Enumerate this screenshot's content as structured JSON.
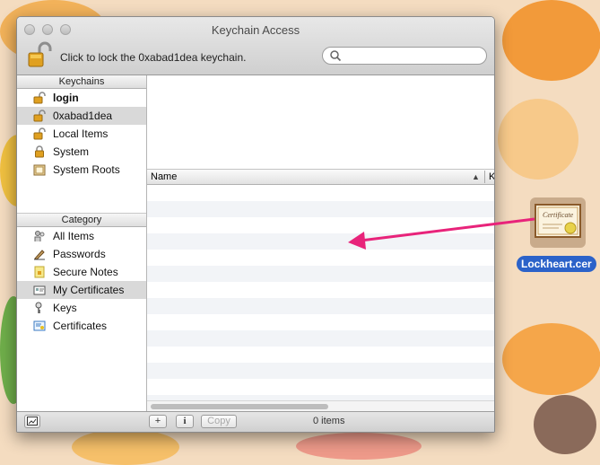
{
  "window": {
    "title": "Keychain Access"
  },
  "toolbar": {
    "lock_text": "Click to lock the 0xabad1dea keychain.",
    "search_placeholder": ""
  },
  "sidebar": {
    "keychains_header": "Keychains",
    "keychains": [
      {
        "label": "login",
        "icon": "lock-open-icon",
        "bold": true,
        "selected": false
      },
      {
        "label": "0xabad1dea",
        "icon": "lock-open-icon",
        "bold": false,
        "selected": true
      },
      {
        "label": "Local Items",
        "icon": "lock-open-icon",
        "bold": false,
        "selected": false
      },
      {
        "label": "System",
        "icon": "lock-closed-icon",
        "bold": false,
        "selected": false
      },
      {
        "label": "System Roots",
        "icon": "cabinet-icon",
        "bold": false,
        "selected": false
      }
    ],
    "category_header": "Category",
    "categories": [
      {
        "label": "All Items",
        "icon": "people-icon",
        "selected": false
      },
      {
        "label": "Passwords",
        "icon": "pen-icon",
        "selected": false
      },
      {
        "label": "Secure Notes",
        "icon": "note-icon",
        "selected": false
      },
      {
        "label": "My Certificates",
        "icon": "certificate-id-icon",
        "selected": true
      },
      {
        "label": "Keys",
        "icon": "key-icon",
        "selected": false
      },
      {
        "label": "Certificates",
        "icon": "certificate-icon",
        "selected": false
      }
    ]
  },
  "list": {
    "columns": [
      "Name",
      "K"
    ]
  },
  "bottombar": {
    "copy_label": "Copy",
    "info_label": "i",
    "add_label": "+",
    "status": "0 items"
  },
  "desktop": {
    "file_label": "Lockheart.cer",
    "cert_text": "Certificate",
    "accent": "#e8237a"
  }
}
